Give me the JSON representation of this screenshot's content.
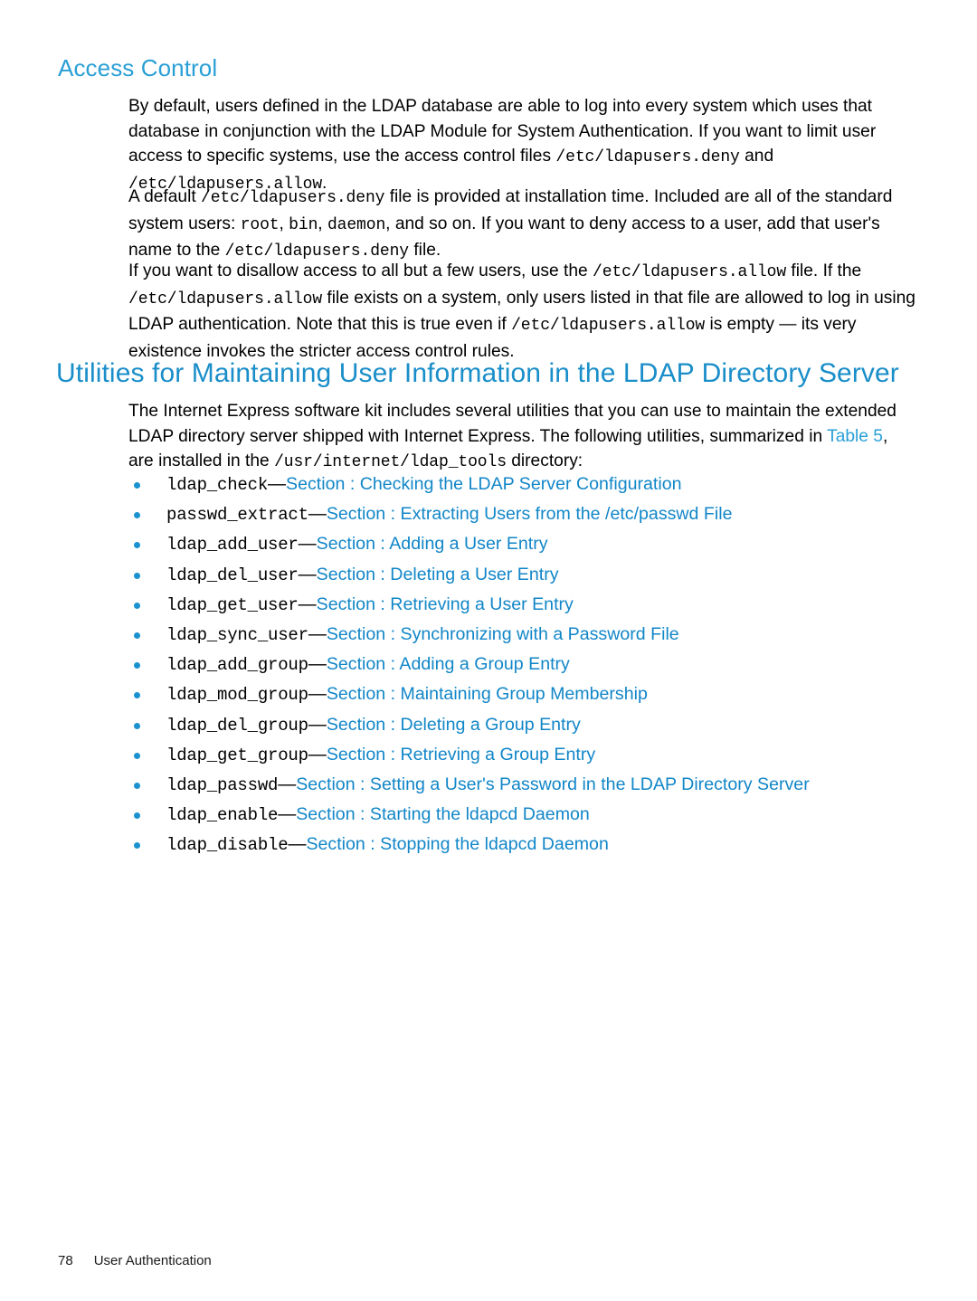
{
  "sections": {
    "access_control": {
      "heading": "Access Control",
      "paragraphs": {
        "p1": {
          "t1": "By default, users defined in the LDAP database are able to log into every system which uses that database in conjunction with the LDAP Module for System Authentication. If you want to limit user access to specific systems, use the access control files ",
          "code1": "/etc/ldapusers.deny",
          "t2": " and ",
          "code2": "/etc/ldapusers.allow",
          "t3": "."
        },
        "p2": {
          "t1": "A default ",
          "code1": "/etc/ldapusers.deny",
          "t2": " file is provided at installation time. Included are all of the standard system users: ",
          "code2": "root",
          "t3": ", ",
          "code3": "bin",
          "t4": ", ",
          "code4": "daemon",
          "t5": ", and so on. If you want to deny access to a user, add that user's name to the ",
          "code5": "/etc/ldapusers.deny",
          "t6": " file."
        },
        "p3": {
          "t1": "If you want to disallow access to all but a few users, use the ",
          "code1": "/etc/ldapusers.allow",
          "t2": " file. If the ",
          "code2": "/etc/ldapusers.allow",
          "t3": " file exists on a system, only users listed in that file are allowed to log in using LDAP authentication. Note that this is true even if ",
          "code3": "/etc/ldapusers.allow",
          "t4": " is empty — its very existence invokes the stricter access control rules."
        }
      }
    },
    "utilities": {
      "heading": "Utilities for Maintaining User Information in the LDAP Directory Server",
      "intro": {
        "t1": "The Internet Express software kit includes several utilities that you can use to maintain the extended LDAP directory server shipped with Internet Express. The following utilities, summarized in ",
        "link": "Table 5",
        "t2": ", are installed in the ",
        "code1": "/usr/internet/ldap_tools",
        "t3": " directory:"
      },
      "items": [
        {
          "command": "ldap_check",
          "dash": "—",
          "section": "Section : Checking the LDAP Server Configuration"
        },
        {
          "command": "passwd_extract",
          "dash": "—",
          "section": "Section : Extracting Users from the /etc/passwd File"
        },
        {
          "command": "ldap_add_user",
          "dash": "—",
          "section": "Section : Adding a User Entry"
        },
        {
          "command": "ldap_del_user",
          "dash": "—",
          "section": "Section : Deleting a User Entry"
        },
        {
          "command": "ldap_get_user",
          "dash": "—",
          "section": "Section : Retrieving a User Entry"
        },
        {
          "command": "ldap_sync_user",
          "dash": "—",
          "section": "Section : Synchronizing with a Password File"
        },
        {
          "command": "ldap_add_group",
          "dash": "—",
          "section": "Section : Adding a Group Entry"
        },
        {
          "command": "ldap_mod_group",
          "dash": "—",
          "section": "Section : Maintaining Group Membership"
        },
        {
          "command": "ldap_del_group",
          "dash": "—",
          "section": "Section : Deleting a Group Entry"
        },
        {
          "command": "ldap_get_group",
          "dash": "—",
          "section": "Section : Retrieving a Group Entry"
        },
        {
          "command": "ldap_passwd",
          "dash": "—",
          "section": "Section : Setting a User's Password in the LDAP Directory Server"
        },
        {
          "command": "ldap_enable",
          "dash": "—",
          "section": "Section : Starting the ldapcd Daemon"
        },
        {
          "command": "ldap_disable",
          "dash": "—",
          "section": "Section : Stopping the ldapcd Daemon"
        }
      ]
    }
  },
  "footer": {
    "page_number": "78",
    "chapter": "User Authentication"
  },
  "colors": {
    "heading_major": "#1a8ec9",
    "heading_minor": "#2a9fd6",
    "link": "#1186c8",
    "bullet": "#1a92cf",
    "body_text": "#000000"
  }
}
